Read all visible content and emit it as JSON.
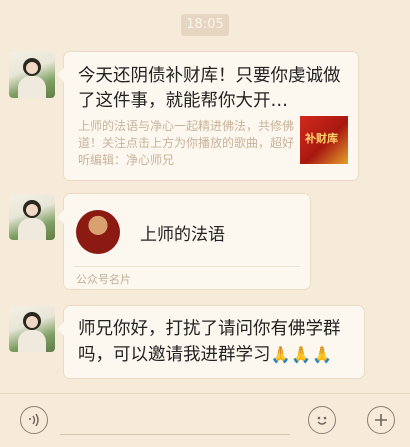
{
  "timestamp": "18:05",
  "messages": [
    {
      "type": "article",
      "title": "今天还阴债补财库！只要你虔诚做了这件事，就能帮你大开…",
      "description": "上师的法语与净心一起精进佛法，共修佛道！关注点击上方为你播放的歌曲，超好听编辑：净心师兄",
      "thumbnail_text": "补财库"
    },
    {
      "type": "card",
      "name": "上师的法语",
      "label": "公众号名片"
    },
    {
      "type": "text",
      "text": "师兄你好，打扰了请问你有佛学群吗，可以邀请我进群学习",
      "emoji": "🙏🙏🙏"
    }
  ],
  "input_bar": {
    "voice_icon": "voice-icon",
    "emoji_icon": "emoji-icon",
    "plus_icon": "plus-icon"
  }
}
